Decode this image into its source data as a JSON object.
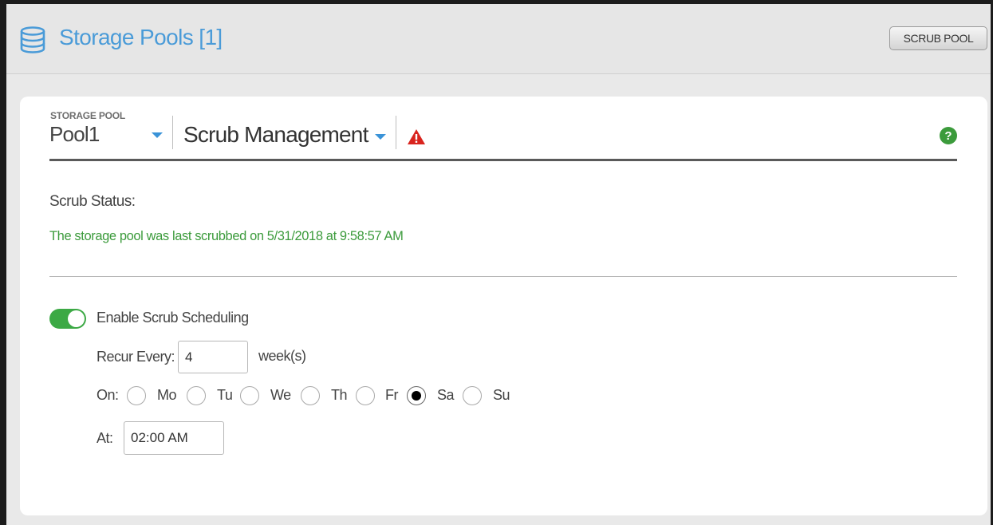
{
  "header": {
    "title": "Storage Pools [1]",
    "icon": "database-icon",
    "scrub_button": "SCRUB POOL"
  },
  "colors": {
    "accent": "#4a9bd8",
    "success": "#3c9b3c",
    "toggle_on": "#3ca945",
    "warning": "#d9241e"
  },
  "selector": {
    "pool_label": "STORAGE POOL",
    "pool_value": "Pool1",
    "section": "Scrub Management",
    "warning_icon": "warning-triangle-icon",
    "help_icon": "help-circle-icon",
    "help_glyph": "?"
  },
  "status": {
    "label": "Scrub Status:",
    "message": "The storage pool was last scrubbed on 5/31/2018 at 9:58:57 AM"
  },
  "schedule": {
    "enabled": true,
    "enable_label": "Enable Scrub Scheduling",
    "recur_label": "Recur Every:",
    "recur_value": "4",
    "recur_unit": "week(s)",
    "on_label": "On:",
    "days": [
      {
        "label": "Mo",
        "checked": false
      },
      {
        "label": "Tu",
        "checked": false
      },
      {
        "label": "We",
        "checked": false
      },
      {
        "label": "Th",
        "checked": false
      },
      {
        "label": "Fr",
        "checked": false
      },
      {
        "label": "Sa",
        "checked": true
      },
      {
        "label": "Su",
        "checked": false
      }
    ],
    "at_label": "At:",
    "time_value": "02:00 AM"
  }
}
